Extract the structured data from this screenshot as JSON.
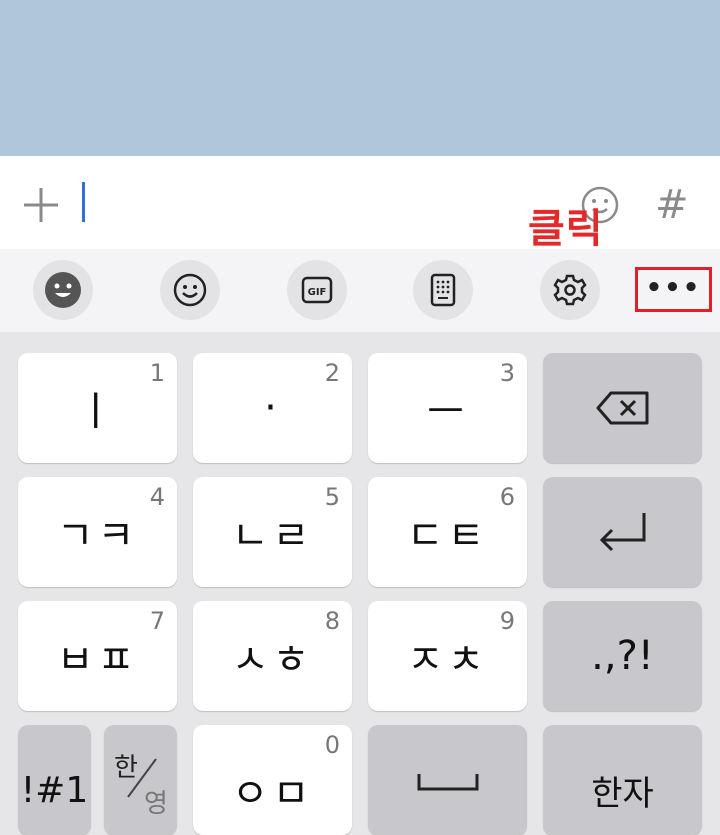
{
  "annotation": {
    "text": "클릭",
    "color": "#e5292b"
  },
  "input_bar": {
    "hash_label": "#"
  },
  "toolbar": {
    "more_label": "•••"
  },
  "keyboard": {
    "rows": [
      [
        {
          "id": "key-1",
          "label": "ㅣ",
          "num": "1"
        },
        {
          "id": "key-2",
          "label": "·",
          "num": "2"
        },
        {
          "id": "key-3",
          "label": "ㅡ",
          "num": "3"
        },
        {
          "id": "key-backspace",
          "icon": "backspace-icon"
        }
      ],
      [
        {
          "id": "key-4",
          "label": "ㄱㅋ",
          "num": "4"
        },
        {
          "id": "key-5",
          "label": "ㄴㄹ",
          "num": "5"
        },
        {
          "id": "key-6",
          "label": "ㄷㅌ",
          "num": "6"
        },
        {
          "id": "key-enter",
          "icon": "enter-icon"
        }
      ],
      [
        {
          "id": "key-7",
          "label": "ㅂㅍ",
          "num": "7"
        },
        {
          "id": "key-8",
          "label": "ㅅㅎ",
          "num": "8"
        },
        {
          "id": "key-9",
          "label": "ㅈㅊ",
          "num": "9"
        },
        {
          "id": "key-punct",
          "label": ".,?!"
        }
      ],
      [
        {
          "id": "key-symbols",
          "label": "!#1"
        },
        {
          "id": "key-lang",
          "top": "한",
          "bottom": "영"
        },
        {
          "id": "key-0",
          "label": "ㅇㅁ",
          "num": "0"
        },
        {
          "id": "key-space",
          "icon": "space-icon"
        },
        {
          "id": "key-hanja",
          "label": "한자"
        }
      ]
    ]
  },
  "colors": {
    "chat_bg": "#b0c6da",
    "caret": "#2f6fd6",
    "highlight": "#e21f26"
  }
}
